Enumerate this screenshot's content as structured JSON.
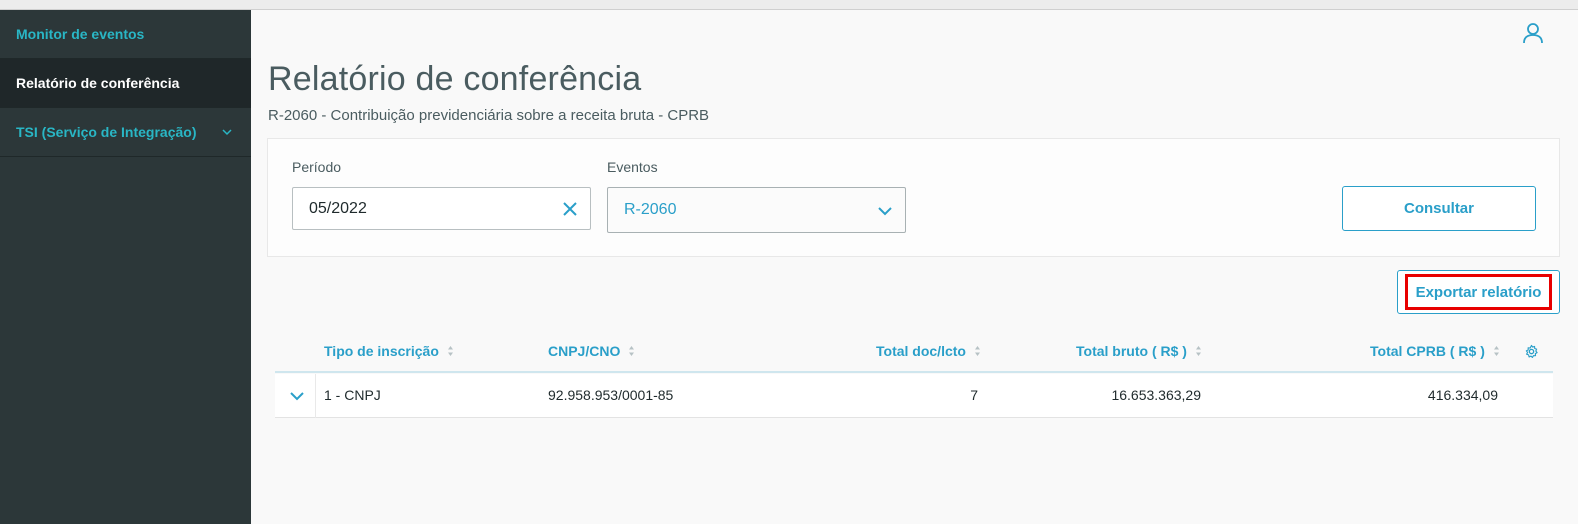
{
  "sidebar": {
    "items": [
      {
        "label": "Monitor de eventos"
      },
      {
        "label": "Relatório de conferência"
      },
      {
        "label": "TSI (Serviço de Integração)"
      }
    ]
  },
  "header": {
    "title": "Relatório de conferência",
    "subtitle": "R-2060 - Contribuição previdenciária sobre a receita bruta - CPRB",
    "user_icon": "user-icon"
  },
  "filters": {
    "periodo_label": "Período",
    "periodo_value": "05/2022",
    "eventos_label": "Eventos",
    "eventos_value": "R-2060",
    "consultar_label": "Consultar"
  },
  "export_label": "Exportar relatório",
  "table": {
    "columns": [
      "Tipo de inscrição",
      "CNPJ/CNO",
      "Total doc/lcto",
      "Total bruto ( R$ )",
      "Total CPRB ( R$ )"
    ],
    "rows": [
      [
        "1 - CNPJ",
        "92.958.953/0001-85",
        "7",
        "16.653.363,29",
        "416.334,09"
      ]
    ]
  },
  "colors": {
    "sidebar_bg": "#2c3739",
    "accent": "#2a9fc9",
    "highlight": "#e80000"
  }
}
